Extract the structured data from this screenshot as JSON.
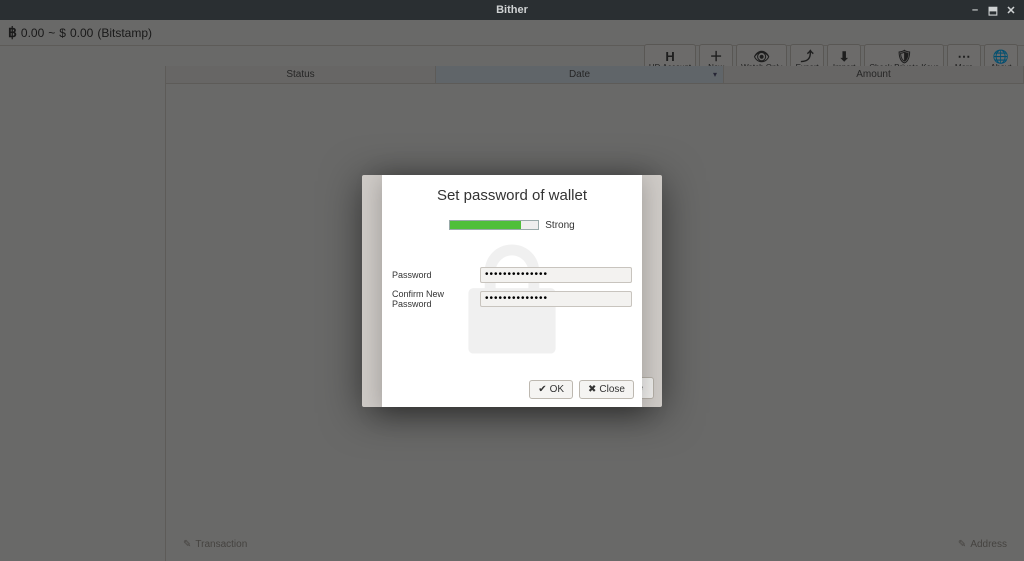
{
  "window": {
    "title": "Bither"
  },
  "balance": {
    "btc_symbol": "฿",
    "btc_amount": "0.00",
    "separator": "~",
    "fiat_symbol": "$",
    "fiat_amount": "0.00",
    "exchange": "(Bitstamp)"
  },
  "toolbar": {
    "hd_account": "HD Account",
    "new": "New",
    "watch_only": "Watch Only",
    "export": "Export",
    "import": "Import",
    "check_private_keys": "Check Private Keys",
    "more": "More",
    "about": "About"
  },
  "columns": {
    "status": "Status",
    "date": "Date",
    "amount": "Amount"
  },
  "footer": {
    "transaction": "Transaction",
    "address": "Address"
  },
  "dialog": {
    "title": "Set password of wallet",
    "strength_label": "Strong",
    "strength_pct": 80,
    "password_label": "Password",
    "confirm_label": "Confirm New Password",
    "password_value": "••••••••••••••",
    "confirm_value": "••••••••••••••",
    "ok": "OK",
    "close": "Close",
    "outer_close_suffix": "se"
  }
}
